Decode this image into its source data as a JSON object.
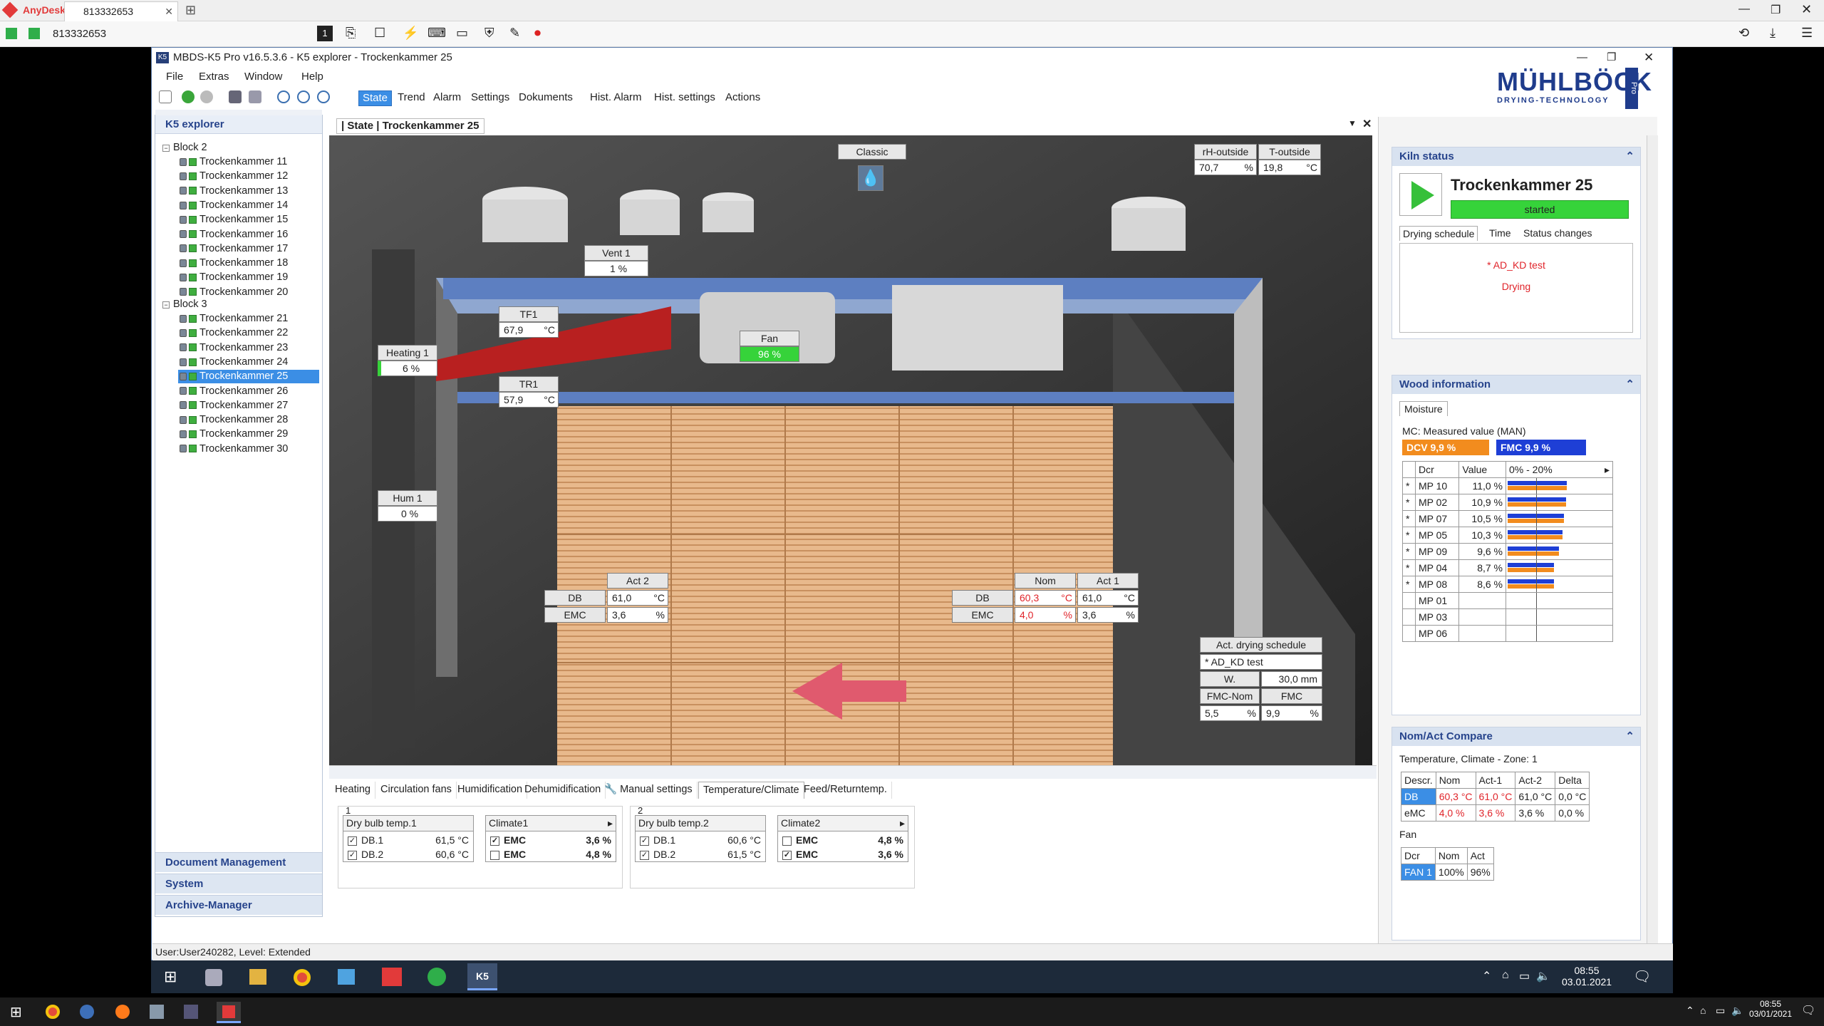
{
  "anydesk": {
    "app": "AnyDesk",
    "tab": "813332653",
    "address": "813332653"
  },
  "window": {
    "title": "MBDS-K5 Pro v16.5.3.6 - K5 explorer - Trockenkammer 25",
    "logo": "MÜHLBÖCK",
    "logo_sub": "DRYING-TECHNOLOGY",
    "logo_side": "Pro"
  },
  "menu": [
    "File",
    "Extras",
    "Window",
    "Help"
  ],
  "toolbar": [
    "State",
    "Trend",
    "Alarm",
    "Settings",
    "Dokuments",
    "Hist. Alarm",
    "Hist. settings",
    "Actions"
  ],
  "explorer": {
    "title": "K5 explorer",
    "block2": "Block 2",
    "block3": "Block 3",
    "items2": [
      "Trockenkammer 11",
      "Trockenkammer 12",
      "Trockenkammer 13",
      "Trockenkammer 14",
      "Trockenkammer 15",
      "Trockenkammer 16",
      "Trockenkammer 17",
      "Trockenkammer 18",
      "Trockenkammer 19",
      "Trockenkammer 20"
    ],
    "items3": [
      "Trockenkammer 21",
      "Trockenkammer 22",
      "Trockenkammer 23",
      "Trockenkammer 24",
      "Trockenkammer 25",
      "Trockenkammer 26",
      "Trockenkammer 27",
      "Trockenkammer 28",
      "Trockenkammer 29",
      "Trockenkammer 30"
    ],
    "nav": [
      "Document Management",
      "System",
      "Archive-Manager"
    ]
  },
  "center": {
    "tab": "| State | Trockenkammer 25",
    "classic": "Classic",
    "rh_outside_label": "rH-outside",
    "rh_outside": "70,7",
    "rh_unit": "%",
    "t_outside_label": "T-outside",
    "t_outside": "19,8",
    "t_unit": "°C",
    "vent_label": "Vent 1",
    "vent": "1 %",
    "tf1_label": "TF1",
    "tf1": "67,9",
    "tr1_label": "TR1",
    "tr1": "57,9",
    "fan_label": "Fan",
    "fan": "96 %",
    "heating_label": "Heating 1",
    "heating": "6 %",
    "hum_label": "Hum 1",
    "hum": "0 %",
    "act2": "Act 2",
    "db": "DB",
    "emc": "EMC",
    "act2_db": "61,0",
    "act2_emc": "3,6",
    "nom": "Nom",
    "act1": "Act 1",
    "nom_db": "60,3",
    "nom_emc": "4,0",
    "act1_db": "61,0",
    "act1_emc": "3,6",
    "c": "°C",
    "pct": "%",
    "sched_label": "Act. drying schedule",
    "sched": "* AD_KD test",
    "w_label": "W.",
    "w": "30,0 mm",
    "fmc_nom_label": "FMC-Nom",
    "fmc_label": "FMC",
    "fmc_nom": "5,5",
    "fmc": "9,9"
  },
  "bottom": {
    "tabs": [
      "Heating",
      "Circulation fans",
      "Humidification",
      "Dehumidification",
      "Manual settings",
      "Temperature/Climate",
      "Feed/Returntemp."
    ],
    "g1": "1",
    "g2": "2",
    "dbt1": "Dry bulb temp.1",
    "dbt2": "Dry bulb temp.2",
    "cl1": "Climate1",
    "cl2": "Climate2",
    "db1": "DB.1",
    "db2": "DB.2",
    "emc": "EMC",
    "g1_db1": "61,5 °C",
    "g1_db2": "60,6 °C",
    "g1_emc1": "3,6 %",
    "g1_emc2": "4,8 %",
    "g2_db1": "60,6 °C",
    "g2_db2": "61,5 °C",
    "g2_emc1": "4,8 %",
    "g2_emc2": "3,6 %"
  },
  "right": {
    "kiln_status": "Kiln status",
    "kiln": "Trockenkammer 25",
    "started": "started",
    "tabs": [
      "Drying schedule",
      "Time",
      "Status changes"
    ],
    "sched": "* AD_KD test",
    "state": "Drying",
    "wood": "Wood information",
    "moisture": "Moisture",
    "mc": "MC: Measured value (MAN)",
    "dcv": "DCV   9,9 %",
    "fmc": "FMC   9,9 %",
    "cols": [
      "Dcr",
      "Value",
      "0% - 20%"
    ],
    "mp": [
      {
        "n": "MP 10",
        "v": "11,0 %",
        "p": 0.55
      },
      {
        "n": "MP 02",
        "v": "10,9 %",
        "p": 0.545
      },
      {
        "n": "MP 07",
        "v": "10,5 %",
        "p": 0.525
      },
      {
        "n": "MP 05",
        "v": "10,3 %",
        "p": 0.515
      },
      {
        "n": "MP 09",
        "v": "9,6 %",
        "p": 0.48
      },
      {
        "n": "MP 04",
        "v": "8,7 %",
        "p": 0.435
      },
      {
        "n": "MP 08",
        "v": "8,6 %",
        "p": 0.43
      },
      {
        "n": "MP 01",
        "v": "",
        "p": 0
      },
      {
        "n": "MP 03",
        "v": "",
        "p": 0
      },
      {
        "n": "MP 06",
        "v": "",
        "p": 0
      }
    ],
    "compare": "Nom/Act Compare",
    "zone": "Temperature, Climate - Zone: 1",
    "ccols": [
      "Descr.",
      "Nom",
      "Act-1",
      "Act-2",
      "Delta"
    ],
    "crows": [
      [
        "DB",
        "60,3 °C",
        "61,0 °C",
        "61,0 °C",
        "0,0 °C"
      ],
      [
        "eMC",
        "4,0 %",
        "3,6 %",
        "3,6 %",
        "0,0 %"
      ]
    ],
    "fan": "Fan",
    "fcols": [
      "Dcr",
      "Nom",
      "Act"
    ],
    "frow": [
      "FAN 1",
      "100%",
      "96%"
    ]
  },
  "status": "User:User240282, Level: Extended",
  "tray": {
    "time1": "08:55",
    "date1": "03.01.2021",
    "time2": "08:55",
    "date2": "03/01/2021"
  },
  "colors": {
    "accent": "#3b8ee5",
    "green": "#36d33a",
    "nav": "#27448c",
    "nom_red": "#e0242a"
  }
}
